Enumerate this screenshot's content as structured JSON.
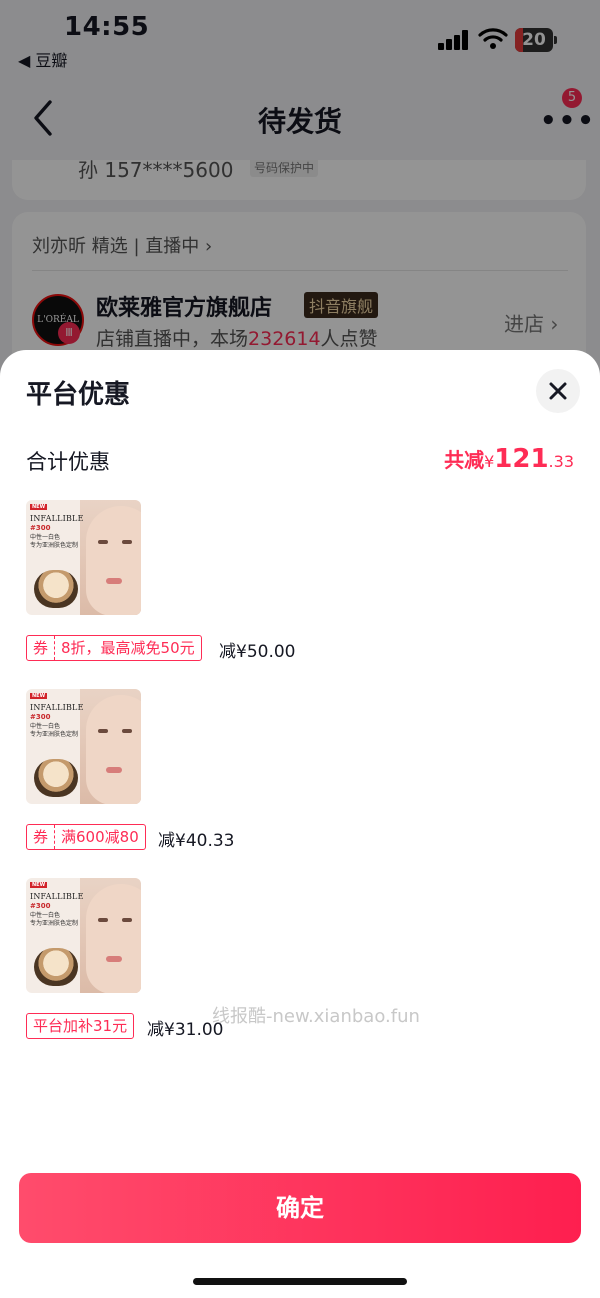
{
  "status_bar": {
    "time": "14:55",
    "back_app": "◀ 豆瓣",
    "battery": "20"
  },
  "nav": {
    "title": "待发货",
    "badge_count": "5"
  },
  "address": {
    "text": "孙 157****5600",
    "protect_tag": "号码保护中"
  },
  "store": {
    "live_row": "刘亦昕 精选 | 直播中 ›",
    "logo_text": "L'ORÉAL",
    "name": "欧莱雅官方旗舰店",
    "tag": "抖音旗舰",
    "desc_prefix": "店铺直播中，本场",
    "viewers": "232614",
    "desc_suffix": "人点赞",
    "enter": "进店 ›"
  },
  "sheet": {
    "title": "平台优惠",
    "total_label": "合计优惠",
    "total_prefix": "共减",
    "total_currency": "¥",
    "total_int": "121",
    "total_dec": ".33",
    "items": [
      {
        "thumb": {
          "new": "NEW",
          "brand": "INFALLIBLE",
          "shade": "#300",
          "line1": "中性一白色",
          "line2": "专为亚洲肤色定制"
        },
        "coupon_tag": "券",
        "coupon_desc": "8折，最高减免50元",
        "discount": "减¥50.00"
      },
      {
        "thumb": {
          "new": "NEW",
          "brand": "INFALLIBLE",
          "shade": "#300",
          "line1": "中性一白色",
          "line2": "专为亚洲肤色定制"
        },
        "coupon_tag": "券",
        "coupon_desc": "满600减80",
        "discount": "减¥40.33"
      },
      {
        "thumb": {
          "new": "NEW",
          "brand": "INFALLIBLE",
          "shade": "#300",
          "line1": "中性一白色",
          "line2": "专为亚洲肤色定制"
        },
        "coupon_tag": "平台加补31元",
        "coupon_desc": "",
        "discount": "减¥31.00"
      }
    ],
    "watermark": "线报酷-new.xianbao.fun",
    "confirm": "确定"
  },
  "colors": {
    "accent": "#fe2c55",
    "button_start": "#ff4c6c",
    "button_end": "#fe1f4f"
  }
}
